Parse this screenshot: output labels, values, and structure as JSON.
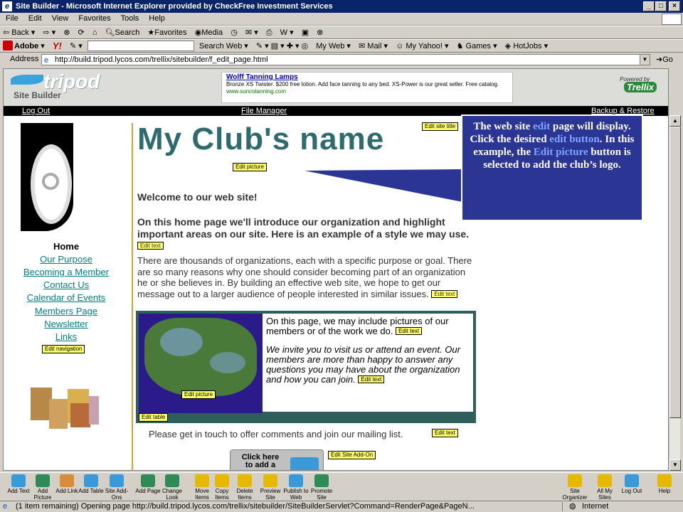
{
  "window": {
    "title": "Site Builder - Microsoft Internet Explorer provided by CheckFree Investment Services"
  },
  "menu": [
    "File",
    "Edit",
    "View",
    "Favorites",
    "Tools",
    "Help"
  ],
  "toolbar": {
    "back": "Back",
    "search": "Search",
    "favorites": "Favorites",
    "media": "Media"
  },
  "linksbar": {
    "adobe": "Adobe",
    "yahoo": "Y!",
    "search_web": "Search Web",
    "my_web": "My Web",
    "mail": "Mail",
    "my_yahoo": "My Yahoo!",
    "games": "Games",
    "hotjobs": "HotJobs"
  },
  "address": {
    "label": "Address",
    "url": "http://build.tripod.lycos.com/trellix/sitebuilder/f_edit_page.html",
    "go": "Go"
  },
  "tripod": {
    "logo": "tripod",
    "subtitle": "Site Builder",
    "powered": "Powered by",
    "trellix": "Trellix"
  },
  "ad": {
    "title": "Wolff Tanning Lamps",
    "body": "Bronze XS Twister. $200 free lotion. Add face tanning to any bed. XS-Power is our great seller. Free catalog.",
    "url": "www.suncotanning.com"
  },
  "topnav": {
    "logout": "Log Out",
    "file_manager": "File Manager",
    "backup": "Backup & Restore"
  },
  "site": {
    "title": "My Club's name",
    "welcome": "Welcome to our web site!",
    "intro": "On this home page we'll introduce our organization and highlight important areas on our site. Here is an example of a style we may use.",
    "body": "There are thousands of organizations, each with a specific purpose or goal. There are so many reasons why one should consider becoming part of an organization he or she believes in. By building an effective web site, we hope to get our message out to a larger audience of people interested in similar issues.",
    "table_text1": "On this page, we may include pictures of our members or of the work we do.",
    "table_text2": "We invite you to visit us or attend an event. Our members are more than happy to answer any questions you may have about the organization and how you can join.",
    "contact": "Please get in touch to offer comments and join our mailing list.",
    "addon": "Click here to add a",
    "nav_home": "Home",
    "nav": [
      "Our Purpose",
      "Becoming a Member",
      "Contact Us",
      "Calendar of Events",
      "Members Page",
      "Newsletter",
      "Links"
    ]
  },
  "edit_buttons": {
    "site_title": "Edit site title",
    "picture": "Edit picture",
    "text": "Edit text",
    "navigation": "Edit navigation",
    "table": "Edit table",
    "addon": "Edit Site Add-On"
  },
  "callout": {
    "p1": "The web site ",
    "h1": "edit",
    "p2": " page will display.  Click the desired ",
    "h2": "edit button",
    "p3": ".  In this example, the ",
    "h3": "Edit picture",
    "p4": " button is selected to add the club’s logo."
  },
  "bottom_toolbar": [
    {
      "label": "Add Text",
      "color": "#3a9ad9"
    },
    {
      "label": "Add Picture",
      "color": "#2e8b57"
    },
    {
      "label": "Add Link",
      "color": "#d98c3a"
    },
    {
      "label": "Add Table",
      "color": "#3a9ad9"
    },
    {
      "label": "Site Add-Ons",
      "color": "#3a9ad9"
    },
    {
      "label": "Add Page",
      "color": "#2e8b57"
    },
    {
      "label": "Change Look",
      "color": "#2e8b57"
    },
    {
      "label": "Move Items",
      "color": "#e6b800"
    },
    {
      "label": "Copy Items",
      "color": "#e6b800"
    },
    {
      "label": "Delete Items",
      "color": "#e6b800"
    },
    {
      "label": "Preview Site",
      "color": "#e6b800"
    },
    {
      "label": "Publish to Web",
      "color": "#3a9ad9"
    },
    {
      "label": "Promote Site",
      "color": "#2e8b57"
    },
    {
      "label": "Site Organizer",
      "color": "#e6b800"
    },
    {
      "label": "All My Sites",
      "color": "#e6b800"
    },
    {
      "label": "Log Out",
      "color": "#3a9ad9"
    },
    {
      "label": "Help",
      "color": "#e6b800"
    }
  ],
  "status": {
    "text": "(1 item remaining) Opening page http://build.tripod.lycos.com/trellix/sitebuilder/SiteBuilderServlet?Command=RenderPage&PageN...",
    "zone": "Internet"
  }
}
